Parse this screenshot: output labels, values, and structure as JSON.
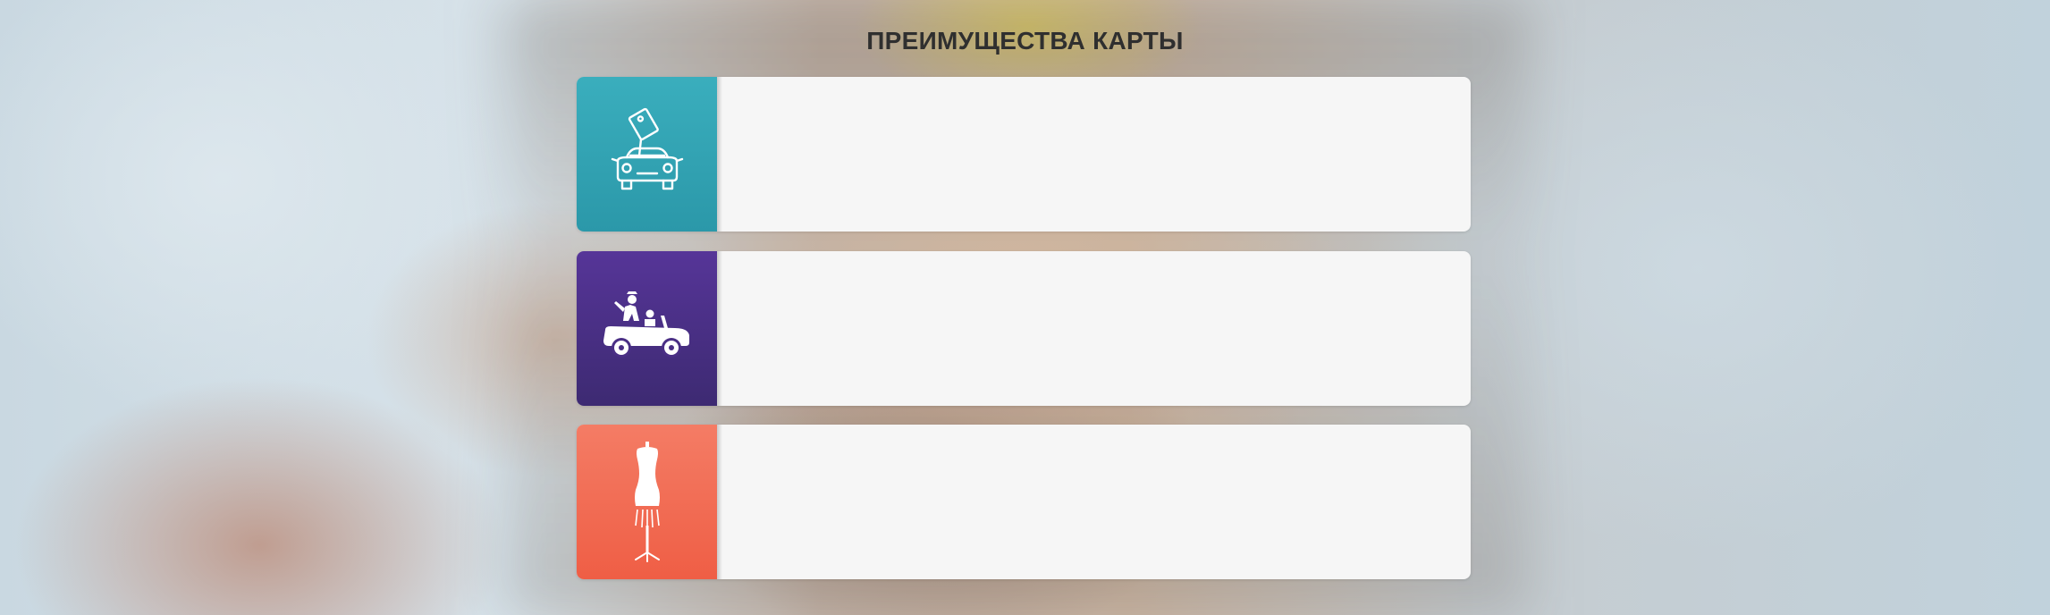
{
  "section": {
    "title": "ПРЕИМУЩЕСТВА КАРТЫ"
  },
  "cards": [
    {
      "icon": "car-price-tag-icon",
      "accent": "#33a5b5",
      "text": ""
    },
    {
      "icon": "convertible-car-icon",
      "accent": "#4a2f85",
      "text": ""
    },
    {
      "icon": "dress-mannequin-icon",
      "accent": "#f26c53",
      "text": ""
    }
  ],
  "colors": {
    "card_background": "#f6f6f6",
    "title_text": "#2f2f2f"
  }
}
